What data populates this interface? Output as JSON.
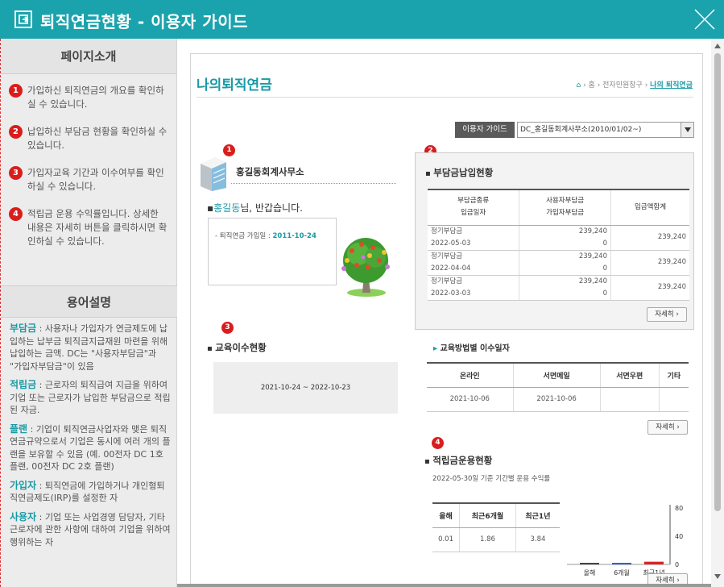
{
  "window": {
    "title": "퇴직연금현황 - 이용자 가이드"
  },
  "left": {
    "intro_heading": "페이지소개",
    "intro_items": [
      {
        "num": "1",
        "text": "가입하신 퇴직연금의 개요를 확인하실 수 있습니다."
      },
      {
        "num": "2",
        "text": "납입하신 부담금 현황을 확인하실 수 있습니다."
      },
      {
        "num": "3",
        "text": "가입자교육 기간과 이수여부를 확인하실 수 있습니다."
      },
      {
        "num": "4",
        "text": "적립금 운용 수익률입니다. 상세한 내용은 자세히 버튼을 클릭하시면 확인하실 수 있습니다."
      }
    ],
    "terms_heading": "용어설명",
    "terms": [
      {
        "term": "부담금",
        "desc": " : 사용자나 가입자가 연금제도에 납입하는 납부금 퇴직금지급재원 마련을 위해 납입하는 금액. DC는 \"사용자부담금\"과 \"가입자부담금\"이 있음"
      },
      {
        "term": "적립금",
        "desc": " : 근로자의 퇴직급여 지급을 위하여 기업 또는 근로자가 납입한 부담금으로 적립된 자금."
      },
      {
        "term": "플랜",
        "desc": " : 기업이 퇴직연금사업자와 맺은 퇴직연금규약으로서 기업은 동시에 여러 개의 플랜을 보유할 수 있음 (예. 00전자 DC 1호 플랜, 00전자 DC 2호 플랜)"
      },
      {
        "term": "가입자",
        "desc": "  : 퇴직연금에 가입하거나 개인형퇴직연금제도(IRP)를 설정한 자"
      },
      {
        "term": "사용자",
        "desc": " : 기업 또는 사업경영 담당자, 기타 근로자에 관한 사항에 대하여 기업을 위하여 행위하는 자"
      }
    ]
  },
  "main": {
    "page_title": "나의퇴직연금",
    "breadcrumb": {
      "home": "홈",
      "section": "전자민원창구",
      "current": "나의 퇴직연금"
    },
    "guide_button": "이용자 가이드",
    "plan_select": "DC_홍길동회계사무소(2010/01/02~)",
    "company": "홍길동회계사무소",
    "greeting_name": "홍길동",
    "greeting_rest": "님, 반갑습니다.",
    "join_label": "- 퇴직연금 가입일 :",
    "join_date": "2011-10-24",
    "payment": {
      "heading": "부담금납입현황",
      "headers": [
        [
          "부담금종류",
          "입금일자"
        ],
        [
          "사용자부담금",
          "가입자부담금"
        ],
        [
          "입금액합계"
        ]
      ],
      "rows": [
        {
          "type": "정기부담금",
          "date": "2022-05-03",
          "employer": "239,240",
          "employee": "0",
          "total": "239,240"
        },
        {
          "type": "정기부담금",
          "date": "2022-04-04",
          "employer": "239,240",
          "employee": "0",
          "total": "239,240"
        },
        {
          "type": "정기부담금",
          "date": "2022-03-03",
          "employer": "239,240",
          "employee": "0",
          "total": "239,240"
        }
      ],
      "more": "자세히"
    },
    "education": {
      "heading": "교육이수현황",
      "period": "2021-10-24 ~ 2022-10-23",
      "method_heading": "교육방법별 이수일자",
      "headers": [
        "온라인",
        "서면메일",
        "서면우편",
        "기타"
      ],
      "values": [
        "2021-10-06",
        "2021-10-06",
        "",
        ""
      ],
      "more": "자세히"
    },
    "fund": {
      "heading": "적립금운용현황",
      "subtitle": "2022-05-30일 기준 기간별 운용 수익률",
      "headers": [
        "올해",
        "최근6개월",
        "최근1년"
      ],
      "values": [
        "0.01",
        "1.86",
        "3.84"
      ],
      "more": "자세히"
    },
    "badges": [
      "1",
      "2",
      "3",
      "4"
    ]
  },
  "chart_data": {
    "type": "bar",
    "categories": [
      "올해",
      "6개월",
      "최근1년"
    ],
    "values": [
      0.01,
      1.86,
      3.84
    ],
    "ylim": [
      0,
      80
    ],
    "yticks": [
      0,
      40,
      80
    ],
    "colors": [
      "#444444",
      "#2f63c8",
      "#d92323"
    ]
  },
  "colors": {
    "accent": "#1aa3ad",
    "badge": "#d91d1d"
  }
}
